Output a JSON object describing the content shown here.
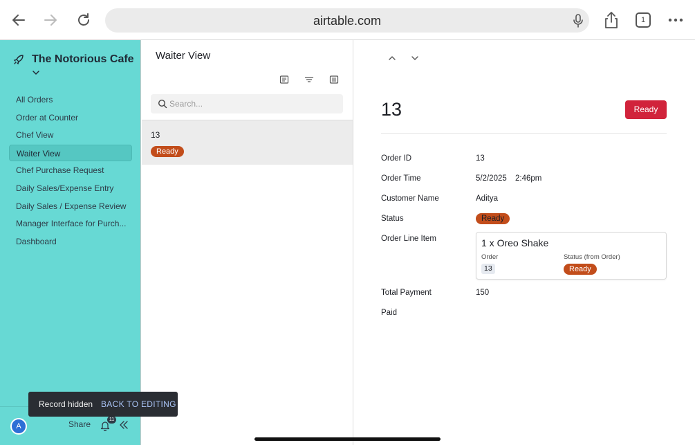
{
  "browser": {
    "url": "airtable.com",
    "tab_count": "1"
  },
  "sidebar": {
    "base_name": "The Notorious Cafe",
    "items": [
      {
        "label": "All Orders"
      },
      {
        "label": "Order at Counter"
      },
      {
        "label": "Chef View"
      },
      {
        "label": "Waiter View"
      },
      {
        "label": "Chef Purchase Request"
      },
      {
        "label": "Daily Sales/Expense Entry"
      },
      {
        "label": "Daily Sales / Expense Review"
      },
      {
        "label": "Manager Interface for Purch..."
      },
      {
        "label": "Dashboard"
      }
    ],
    "active_index": 3,
    "footer": {
      "avatar_initial": "A",
      "share_label": "Share",
      "notification_count": "11"
    }
  },
  "list": {
    "title": "Waiter View",
    "search_placeholder": "Search...",
    "record": {
      "title": "13",
      "status": "Ready"
    }
  },
  "detail": {
    "record_title": "13",
    "status_button": "Ready",
    "fields": {
      "order_id": {
        "label": "Order ID",
        "value": "13"
      },
      "order_time": {
        "label": "Order Time",
        "date": "5/2/2025",
        "time": "2:46pm"
      },
      "customer_name": {
        "label": "Customer Name",
        "value": "Aditya"
      },
      "status": {
        "label": "Status",
        "value": "Ready"
      },
      "order_line_item": {
        "label": "Order Line Item",
        "card": {
          "title": "1 x Oreo Shake",
          "order_label": "Order",
          "order_value": "13",
          "status_label": "Status (from Order)",
          "status_value": "Ready"
        }
      },
      "total_payment": {
        "label": "Total Payment",
        "value": "150"
      },
      "paid": {
        "label": "Paid"
      }
    }
  },
  "toast": {
    "message": "Record hidden",
    "action": "BACK TO EDITING"
  },
  "colors": {
    "sidebar_bg": "#67d9d4",
    "status_pill": "#c24d1b",
    "status_button": "#d1233b"
  }
}
